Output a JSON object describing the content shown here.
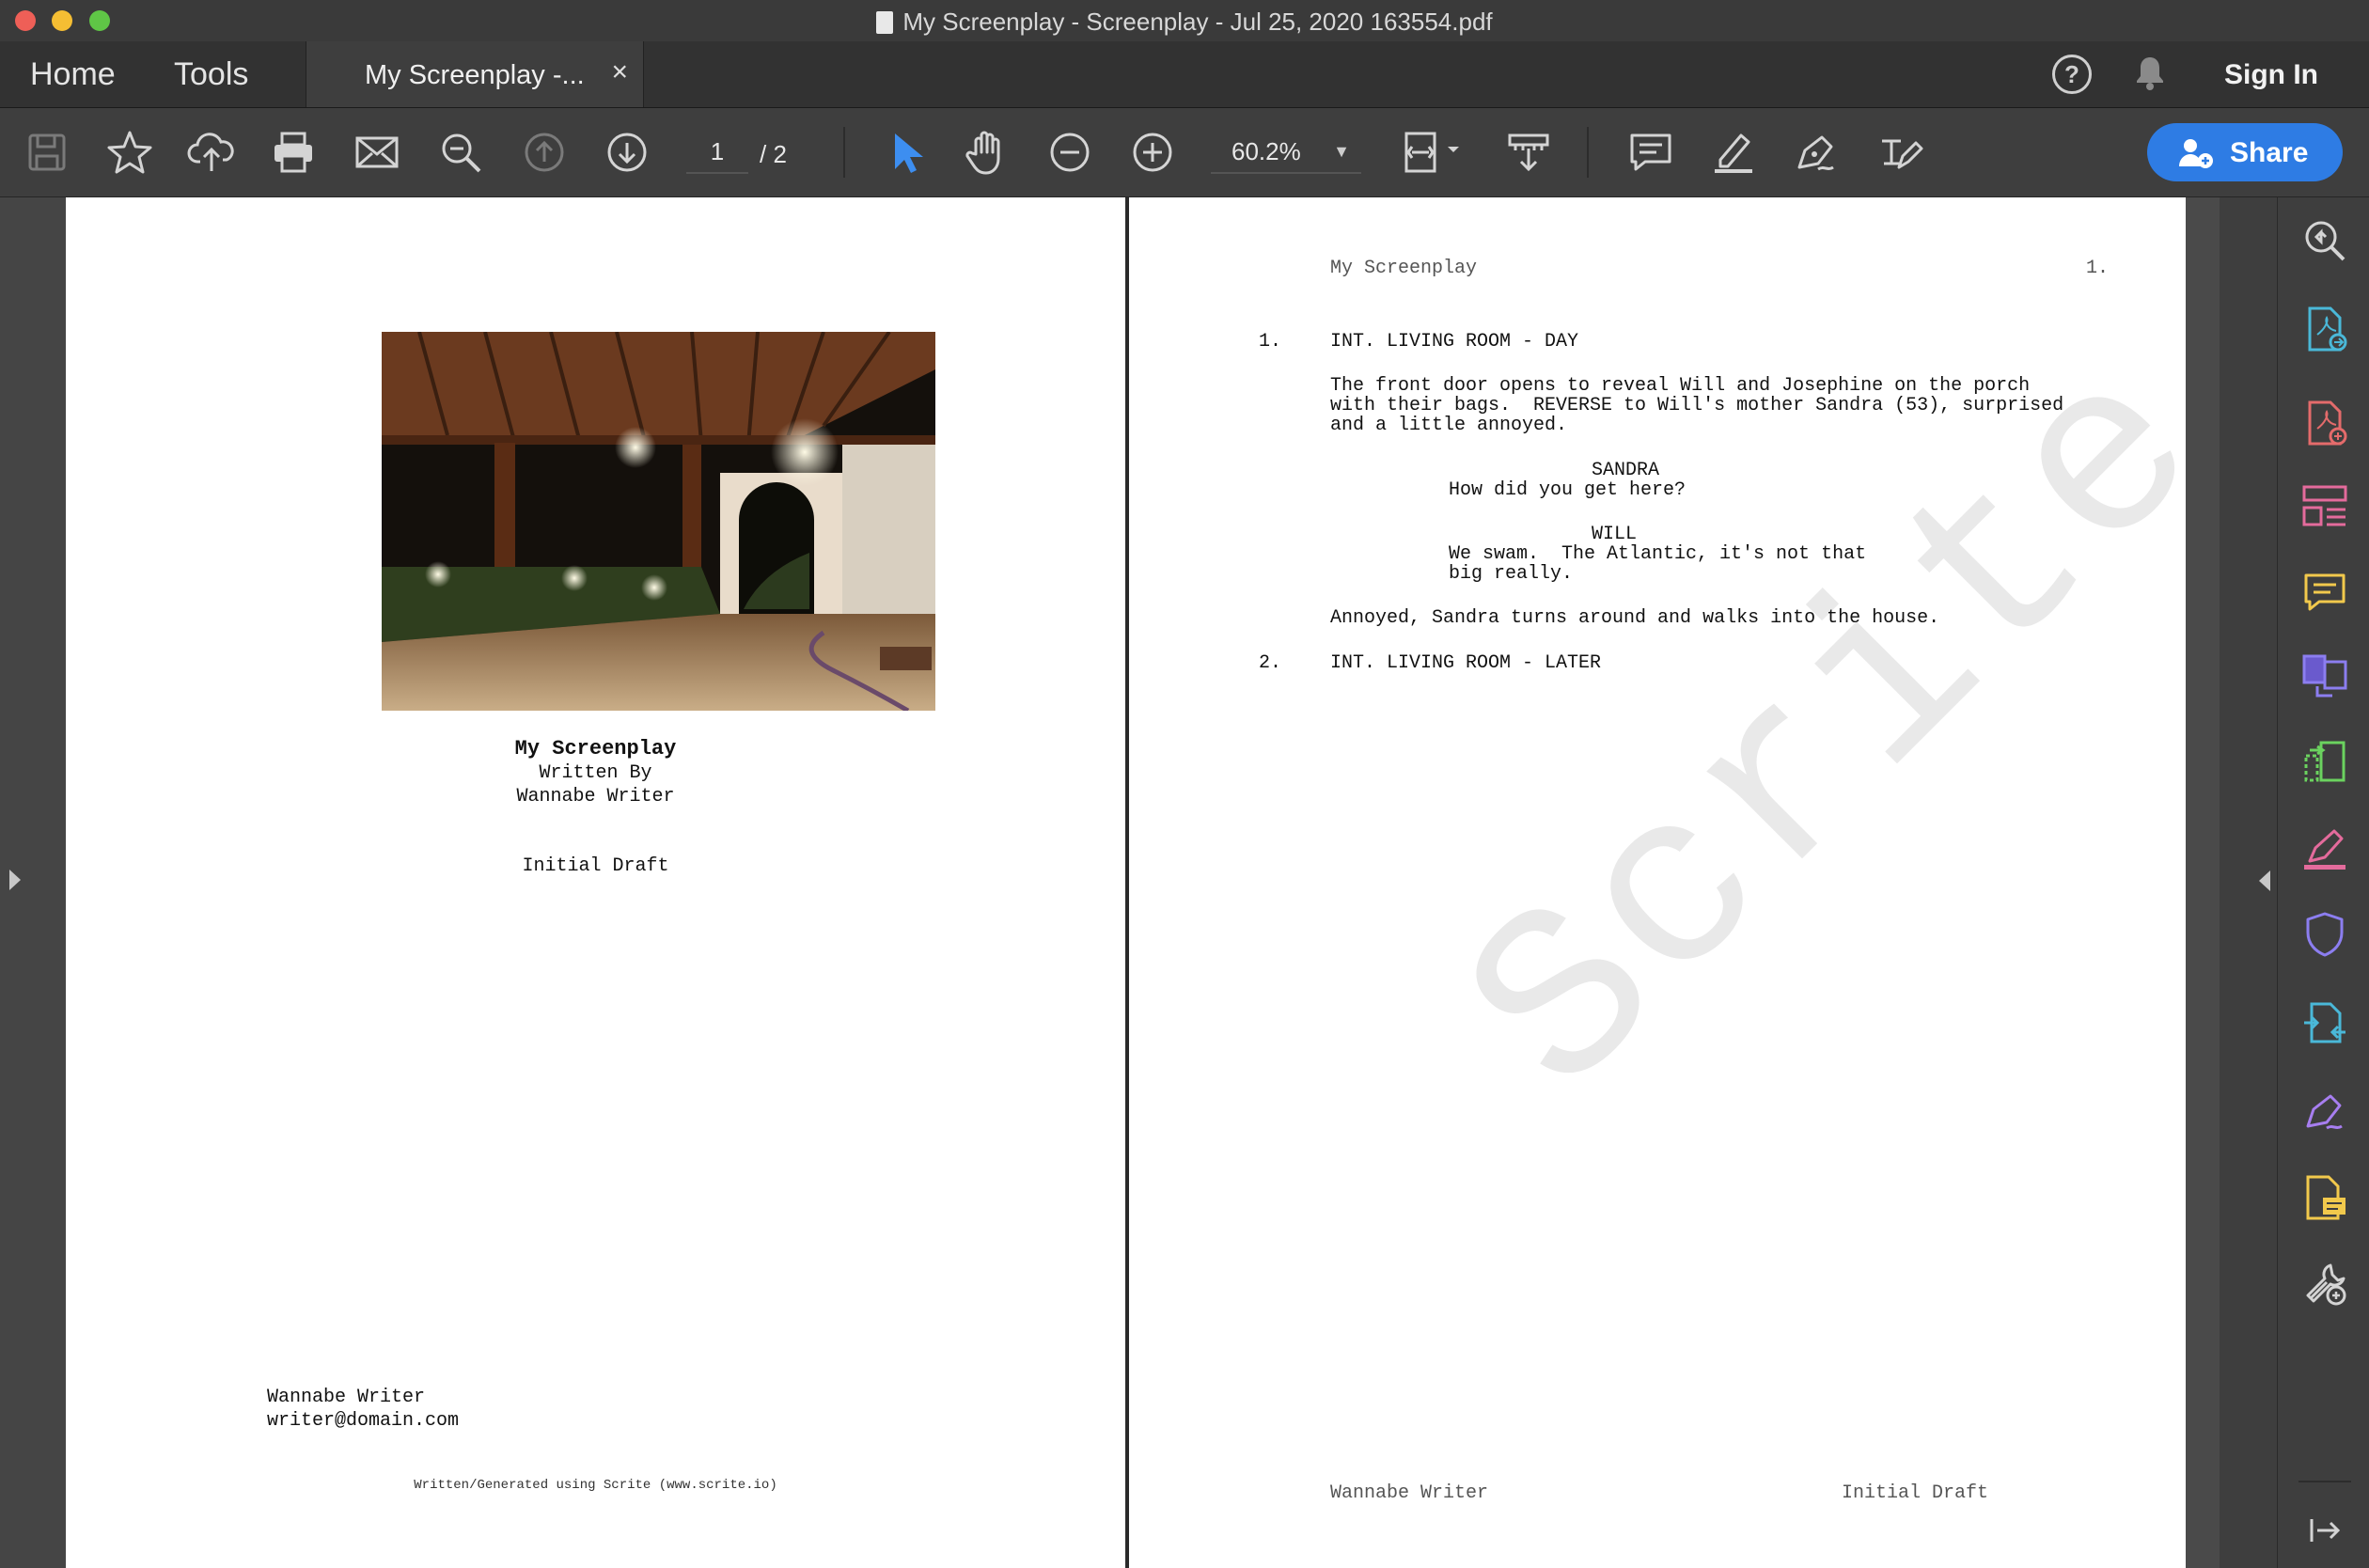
{
  "window": {
    "title": "My Screenplay - Screenplay - Jul 25, 2020 163554.pdf"
  },
  "nav": {
    "home": "Home",
    "tools": "Tools",
    "tab_label": "My Screenplay -...",
    "tab_close": "×",
    "help": "?",
    "sign_in": "Sign In"
  },
  "toolbar": {
    "page_current": "1",
    "page_total": "/ 2",
    "zoom": "60.2%",
    "share": "Share"
  },
  "colors": {
    "accent": "#2e7ce4",
    "select_tool": "#3d8ef0"
  },
  "right_panel_icons": [
    "zoom-search-icon",
    "export-pdf-icon",
    "create-pdf-icon",
    "organize-pages-icon",
    "comment-icon",
    "combine-files-icon",
    "compress-icon",
    "fill-sign-icon",
    "protect-icon",
    "convert-icon",
    "sign-icon",
    "send-for-comments-icon",
    "more-tools-icon",
    "collapse-panel-icon"
  ],
  "page1": {
    "title": "My Screenplay",
    "written_by": "Written By",
    "author": "Wannabe Writer",
    "draft": "Initial Draft",
    "contact_name": "Wannabe Writer",
    "contact_email": "writer@domain.com",
    "footer": "Written/Generated using Scrite (www.scrite.io)"
  },
  "page2": {
    "header_title": "My Screenplay",
    "header_page": "1.",
    "scene1_num": "1.",
    "scene1_heading": "INT. LIVING ROOM - DAY",
    "action1_l1": "The front door opens to reveal Will and Josephine on the porch",
    "action1_l2": "with their bags.  REVERSE to Will's mother Sandra (53), surprised",
    "action1_l3": "and a little annoyed.",
    "char1": "SANDRA",
    "dial1": "How did you get here?",
    "char2": "WILL",
    "dial2_l1": "We swam.  The Atlantic, it's not that",
    "dial2_l2": "big really.",
    "action2": "Annoyed, Sandra turns around and walks into the house.",
    "scene2_num": "2.",
    "scene2_heading": "INT. LIVING ROOM - LATER",
    "watermark": "Scrite",
    "footer_left": "Wannabe Writer",
    "footer_right": "Initial Draft"
  }
}
